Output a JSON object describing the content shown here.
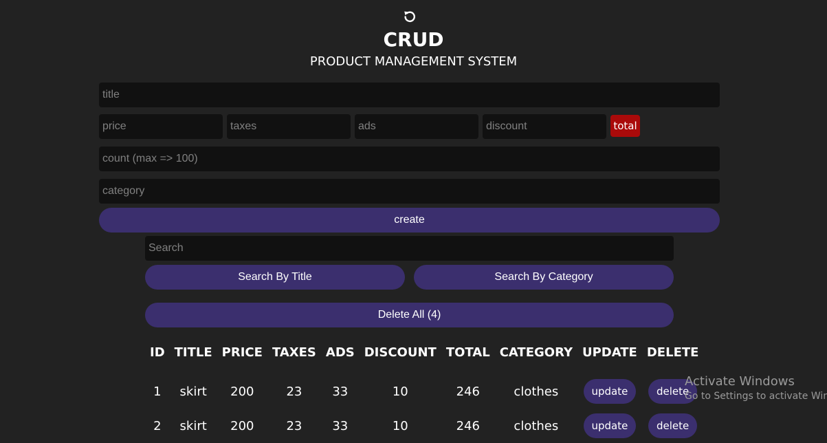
{
  "header": {
    "icon": "reload-icon",
    "title": "CRUD",
    "subtitle": "PRODUCT MANAGEMENT SYSTEM"
  },
  "form": {
    "title_placeholder": "title",
    "price_placeholder": "price",
    "taxes_placeholder": "taxes",
    "ads_placeholder": "ads",
    "discount_placeholder": "discount",
    "total_label": "total",
    "count_placeholder": "count (max => 100)",
    "category_placeholder": "category",
    "create_label": "create"
  },
  "search": {
    "placeholder": "Search",
    "by_title_label": "Search By Title",
    "by_category_label": "Search By Category",
    "delete_all_label": "Delete All (4)"
  },
  "table": {
    "headers": [
      "ID",
      "TITLE",
      "PRICE",
      "TAXES",
      "ADS",
      "DISCOUNT",
      "TOTAL",
      "CATEGORY",
      "UPDATE",
      "DELETE"
    ],
    "rows": [
      {
        "id": "1",
        "title": "skirt",
        "price": "200",
        "taxes": "23",
        "ads": "33",
        "discount": "10",
        "total": "246",
        "category": "clothes",
        "update": "update",
        "delete": "delete"
      },
      {
        "id": "2",
        "title": "skirt",
        "price": "200",
        "taxes": "23",
        "ads": "33",
        "discount": "10",
        "total": "246",
        "category": "clothes",
        "update": "update",
        "delete": "delete"
      }
    ]
  },
  "watermark": {
    "line1": "Activate Windows",
    "line2": "Go to Settings to activate Windows."
  },
  "colors": {
    "background": "#222222",
    "input_bg": "#111111",
    "button": "#3b2f6e",
    "total_badge": "#aa0a0a"
  }
}
